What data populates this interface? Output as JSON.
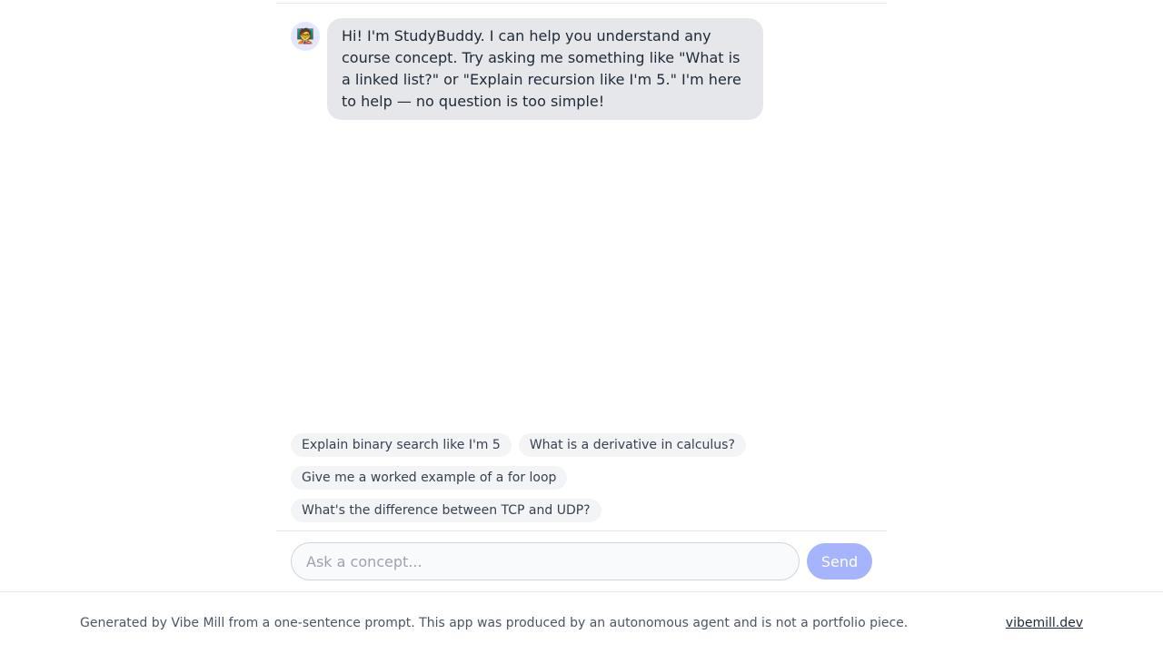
{
  "chat": {
    "assistant_avatar_icon": "teacher-emoji-icon",
    "assistant_avatar_glyph": "🧑‍🏫",
    "messages": [
      {
        "role": "assistant",
        "text": "Hi! I'm StudyBuddy. I can help you understand any course concept. Try asking me something like \"What is a linked list?\" or \"Explain recursion like I'm 5.\" I'm here to help — no question is too simple!"
      }
    ]
  },
  "suggestions": [
    "Explain binary search like I'm 5",
    "What is a derivative in calculus?",
    "Give me a worked example of a for loop",
    "What's the difference between TCP and UDP?"
  ],
  "input": {
    "placeholder": "Ask a concept...",
    "value": "",
    "send_label": "Send"
  },
  "footer": {
    "text": "Generated by Vibe Mill from a one-sentence prompt. This app was produced by an autonomous agent and is not a portfolio piece.",
    "link_label": "vibemill.dev"
  },
  "colors": {
    "accent": "#a5b4fc",
    "bubble": "#e5e7eb",
    "chip": "#f3f4f6",
    "avatar_bg": "#e0e7ff"
  }
}
